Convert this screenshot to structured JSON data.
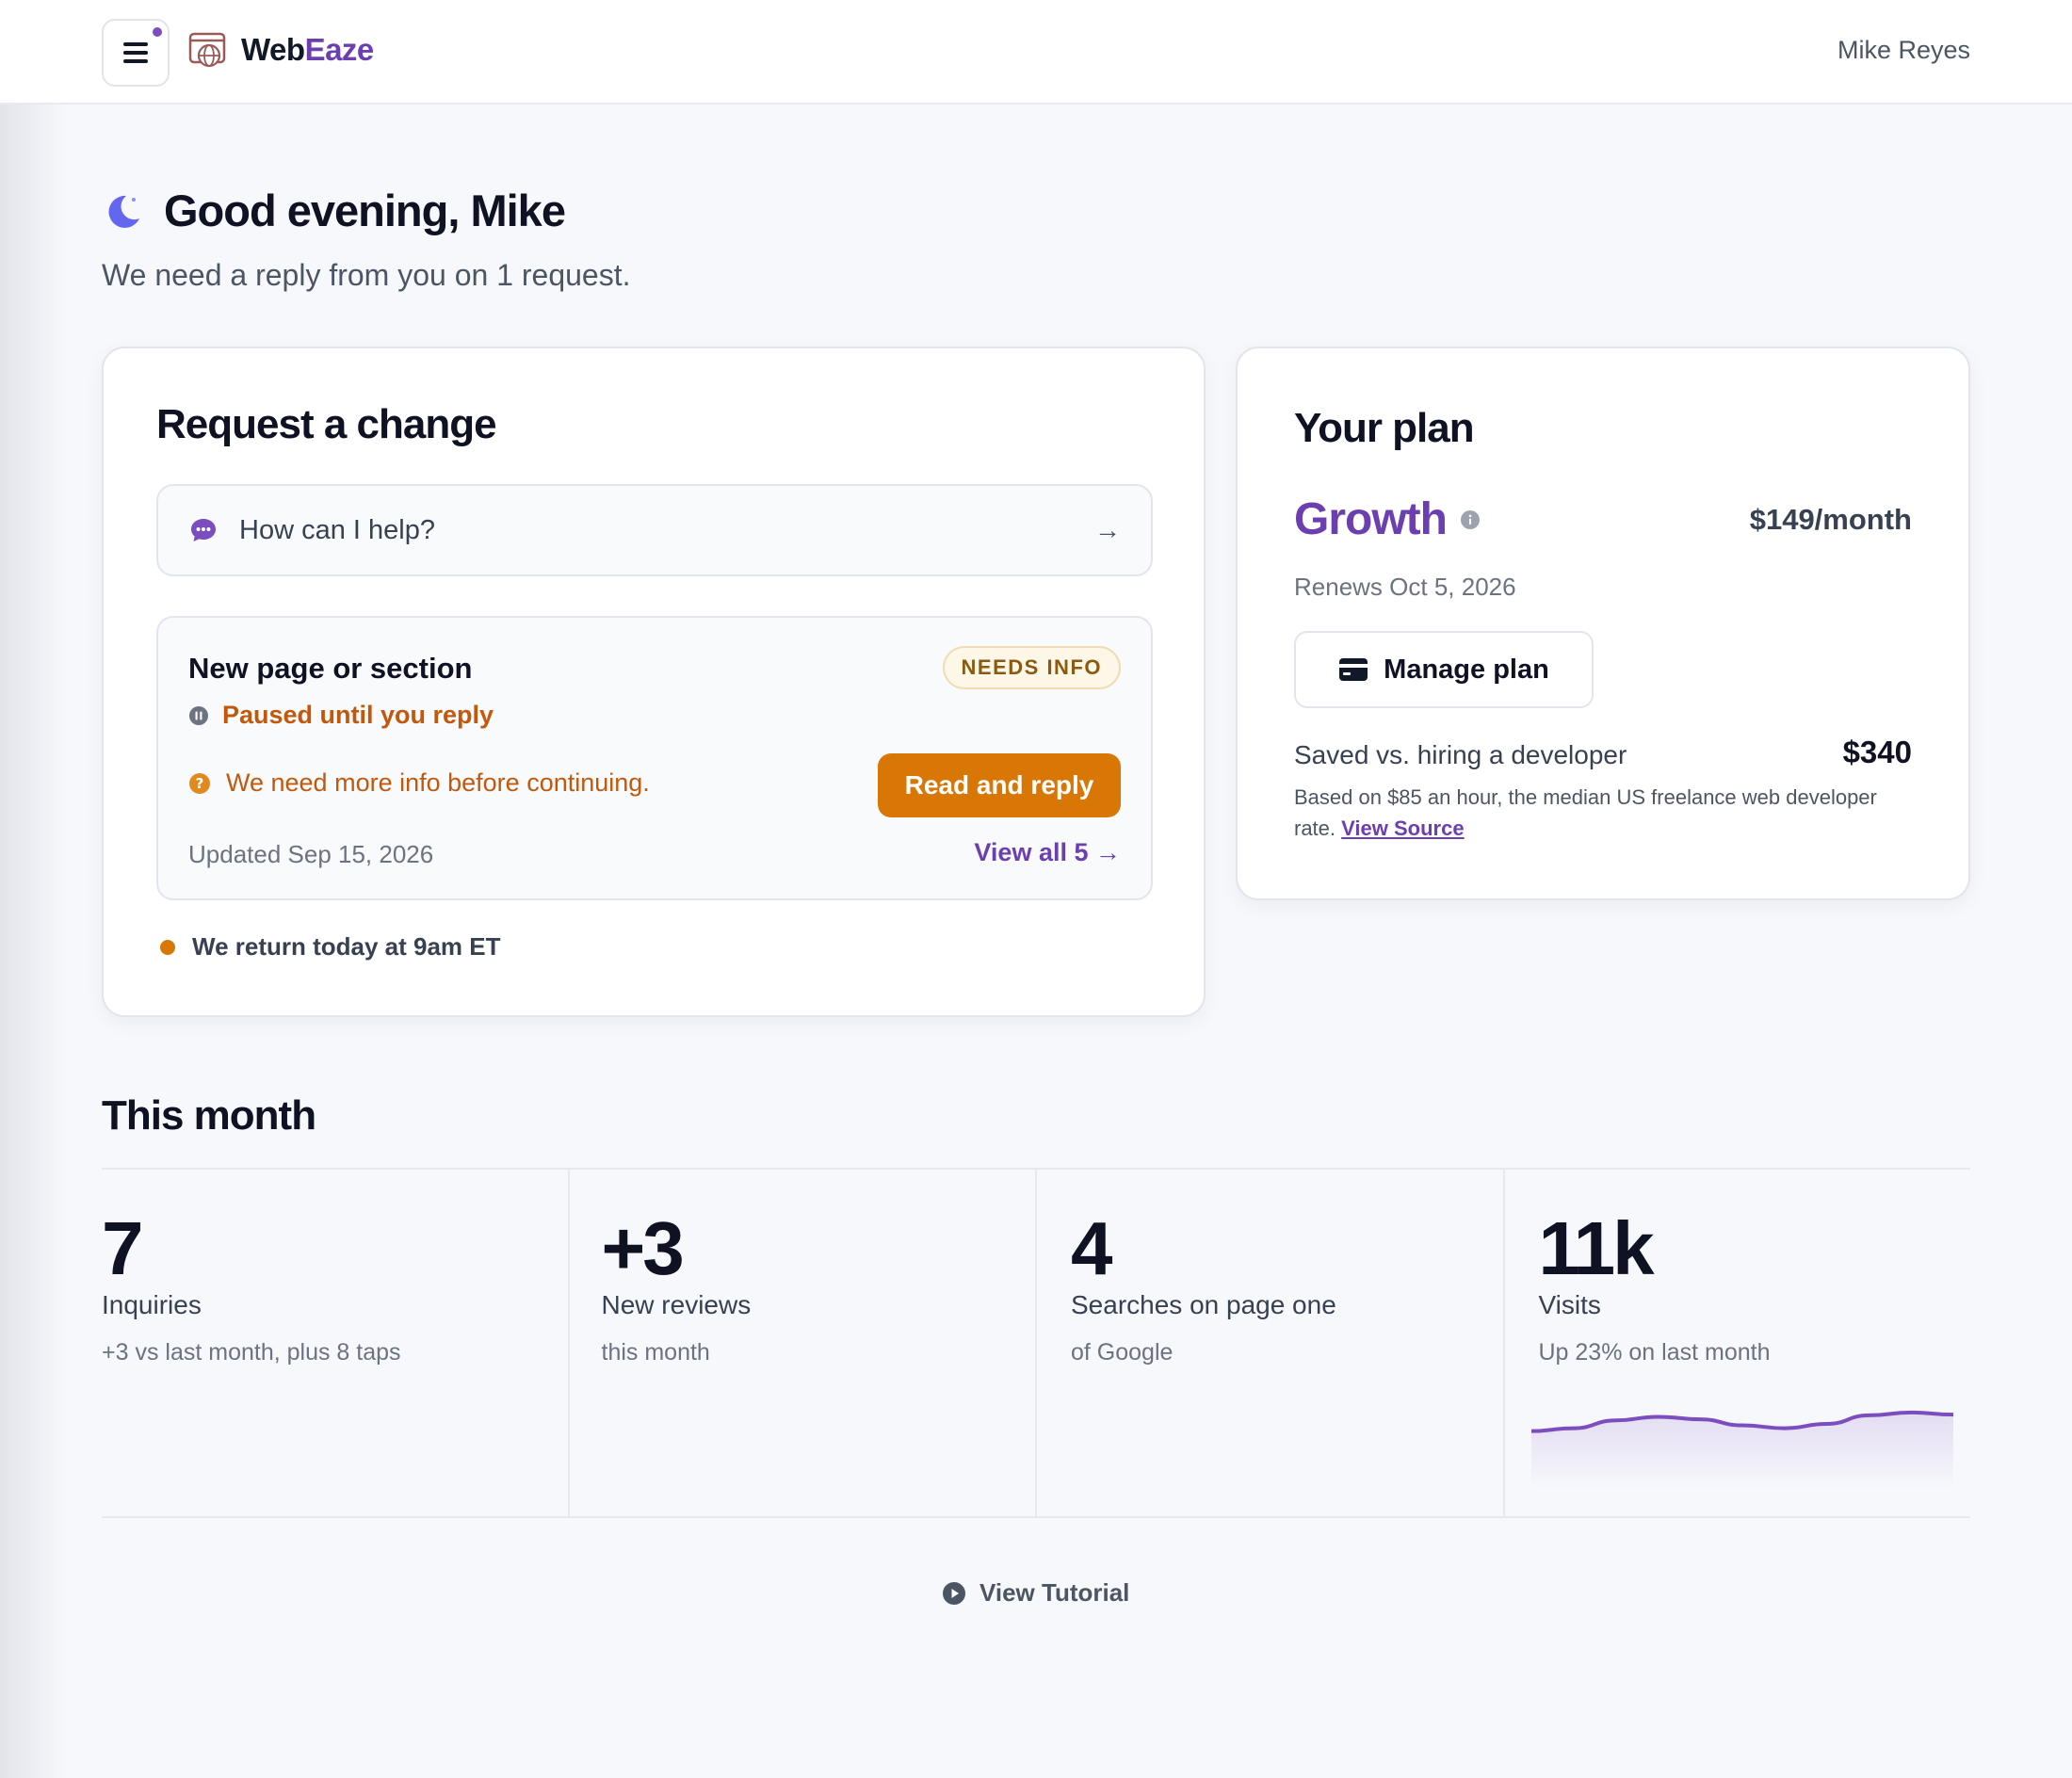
{
  "header": {
    "brand_prefix": "Web",
    "brand_accent": "Eaze",
    "user_name": "Mike Reyes",
    "menu_icon": "hamburger-menu-icon",
    "logo_icon": "browser-globe-icon"
  },
  "greeting": {
    "title": "Good evening, Mike",
    "subtitle": "We need a reply from you on 1 request.",
    "icon": "moon-icon"
  },
  "request_card": {
    "title": "Request a change",
    "input_placeholder": "How can I help?",
    "input_icon": "chat-bubble-icon",
    "submit_icon": "→",
    "item": {
      "title": "New page or section",
      "badge": "NEEDS INFO",
      "paused_text": "Paused until you reply",
      "info_text": "We need more info before continuing.",
      "reply_button": "Read and reply",
      "updated": "Updated Sep 15, 2026",
      "view_all": "View all 5 →"
    },
    "return_text": "We return today at 9am ET"
  },
  "plan_card": {
    "title": "Your plan",
    "plan_name": "Growth",
    "price": "$149/month",
    "renews": "Renews Oct 5, 2026",
    "manage_button": "Manage plan",
    "saved_label": "Saved vs. hiring a developer",
    "saved_value": "$340",
    "saved_note": "Based on $85 an hour, the median US freelance web developer rate.",
    "view_source": "View Source"
  },
  "this_month": {
    "title": "This month",
    "stats": [
      {
        "value": "7",
        "label": "Inquiries",
        "sub": "+3 vs last month, plus 8 taps"
      },
      {
        "value": "+3",
        "label": "New reviews",
        "sub": "this month"
      },
      {
        "value": "4",
        "label": "Searches on page one",
        "sub": "of Google"
      },
      {
        "value": "11k",
        "label": "Visits",
        "sub": "Up 23% on last month"
      }
    ],
    "visits_trend": [
      0.22,
      0.3,
      0.52,
      0.62,
      0.55,
      0.38,
      0.3,
      0.42,
      0.66,
      0.74,
      0.68
    ]
  },
  "tutorial": {
    "label": "View Tutorial",
    "icon": "play-circle-icon"
  },
  "colors": {
    "accent": "#6c3fb0",
    "warning": "#d97706",
    "warning_text": "#c2580c"
  }
}
